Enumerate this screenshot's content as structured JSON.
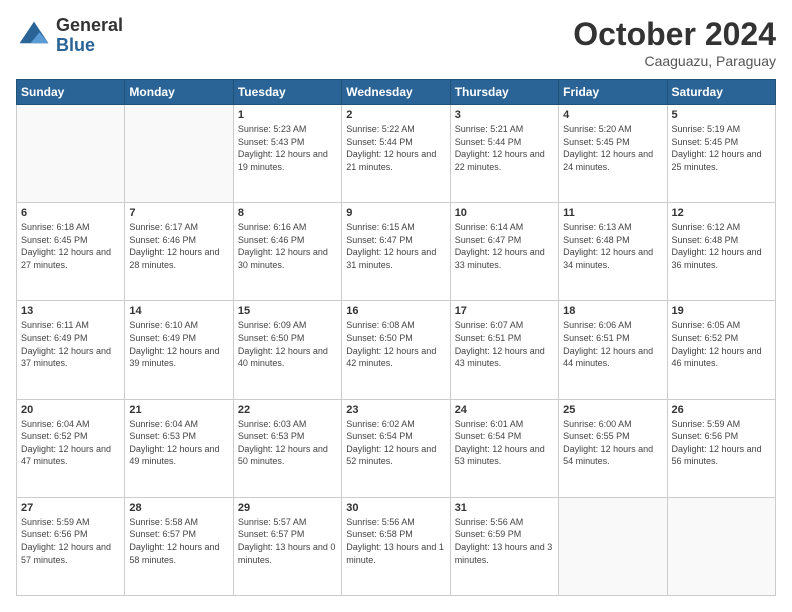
{
  "header": {
    "logo_general": "General",
    "logo_blue": "Blue",
    "month_title": "October 2024",
    "location": "Caaguazu, Paraguay"
  },
  "days_of_week": [
    "Sunday",
    "Monday",
    "Tuesday",
    "Wednesday",
    "Thursday",
    "Friday",
    "Saturday"
  ],
  "weeks": [
    [
      {
        "day": "",
        "info": ""
      },
      {
        "day": "",
        "info": ""
      },
      {
        "day": "1",
        "info": "Sunrise: 5:23 AM\nSunset: 5:43 PM\nDaylight: 12 hours\nand 19 minutes."
      },
      {
        "day": "2",
        "info": "Sunrise: 5:22 AM\nSunset: 5:44 PM\nDaylight: 12 hours\nand 21 minutes."
      },
      {
        "day": "3",
        "info": "Sunrise: 5:21 AM\nSunset: 5:44 PM\nDaylight: 12 hours\nand 22 minutes."
      },
      {
        "day": "4",
        "info": "Sunrise: 5:20 AM\nSunset: 5:45 PM\nDaylight: 12 hours\nand 24 minutes."
      },
      {
        "day": "5",
        "info": "Sunrise: 5:19 AM\nSunset: 5:45 PM\nDaylight: 12 hours\nand 25 minutes."
      }
    ],
    [
      {
        "day": "6",
        "info": "Sunrise: 6:18 AM\nSunset: 6:45 PM\nDaylight: 12 hours\nand 27 minutes."
      },
      {
        "day": "7",
        "info": "Sunrise: 6:17 AM\nSunset: 6:46 PM\nDaylight: 12 hours\nand 28 minutes."
      },
      {
        "day": "8",
        "info": "Sunrise: 6:16 AM\nSunset: 6:46 PM\nDaylight: 12 hours\nand 30 minutes."
      },
      {
        "day": "9",
        "info": "Sunrise: 6:15 AM\nSunset: 6:47 PM\nDaylight: 12 hours\nand 31 minutes."
      },
      {
        "day": "10",
        "info": "Sunrise: 6:14 AM\nSunset: 6:47 PM\nDaylight: 12 hours\nand 33 minutes."
      },
      {
        "day": "11",
        "info": "Sunrise: 6:13 AM\nSunset: 6:48 PM\nDaylight: 12 hours\nand 34 minutes."
      },
      {
        "day": "12",
        "info": "Sunrise: 6:12 AM\nSunset: 6:48 PM\nDaylight: 12 hours\nand 36 minutes."
      }
    ],
    [
      {
        "day": "13",
        "info": "Sunrise: 6:11 AM\nSunset: 6:49 PM\nDaylight: 12 hours\nand 37 minutes."
      },
      {
        "day": "14",
        "info": "Sunrise: 6:10 AM\nSunset: 6:49 PM\nDaylight: 12 hours\nand 39 minutes."
      },
      {
        "day": "15",
        "info": "Sunrise: 6:09 AM\nSunset: 6:50 PM\nDaylight: 12 hours\nand 40 minutes."
      },
      {
        "day": "16",
        "info": "Sunrise: 6:08 AM\nSunset: 6:50 PM\nDaylight: 12 hours\nand 42 minutes."
      },
      {
        "day": "17",
        "info": "Sunrise: 6:07 AM\nSunset: 6:51 PM\nDaylight: 12 hours\nand 43 minutes."
      },
      {
        "day": "18",
        "info": "Sunrise: 6:06 AM\nSunset: 6:51 PM\nDaylight: 12 hours\nand 44 minutes."
      },
      {
        "day": "19",
        "info": "Sunrise: 6:05 AM\nSunset: 6:52 PM\nDaylight: 12 hours\nand 46 minutes."
      }
    ],
    [
      {
        "day": "20",
        "info": "Sunrise: 6:04 AM\nSunset: 6:52 PM\nDaylight: 12 hours\nand 47 minutes."
      },
      {
        "day": "21",
        "info": "Sunrise: 6:04 AM\nSunset: 6:53 PM\nDaylight: 12 hours\nand 49 minutes."
      },
      {
        "day": "22",
        "info": "Sunrise: 6:03 AM\nSunset: 6:53 PM\nDaylight: 12 hours\nand 50 minutes."
      },
      {
        "day": "23",
        "info": "Sunrise: 6:02 AM\nSunset: 6:54 PM\nDaylight: 12 hours\nand 52 minutes."
      },
      {
        "day": "24",
        "info": "Sunrise: 6:01 AM\nSunset: 6:54 PM\nDaylight: 12 hours\nand 53 minutes."
      },
      {
        "day": "25",
        "info": "Sunrise: 6:00 AM\nSunset: 6:55 PM\nDaylight: 12 hours\nand 54 minutes."
      },
      {
        "day": "26",
        "info": "Sunrise: 5:59 AM\nSunset: 6:56 PM\nDaylight: 12 hours\nand 56 minutes."
      }
    ],
    [
      {
        "day": "27",
        "info": "Sunrise: 5:59 AM\nSunset: 6:56 PM\nDaylight: 12 hours\nand 57 minutes."
      },
      {
        "day": "28",
        "info": "Sunrise: 5:58 AM\nSunset: 6:57 PM\nDaylight: 12 hours\nand 58 minutes."
      },
      {
        "day": "29",
        "info": "Sunrise: 5:57 AM\nSunset: 6:57 PM\nDaylight: 13 hours\nand 0 minutes."
      },
      {
        "day": "30",
        "info": "Sunrise: 5:56 AM\nSunset: 6:58 PM\nDaylight: 13 hours\nand 1 minute."
      },
      {
        "day": "31",
        "info": "Sunrise: 5:56 AM\nSunset: 6:59 PM\nDaylight: 13 hours\nand 3 minutes."
      },
      {
        "day": "",
        "info": ""
      },
      {
        "day": "",
        "info": ""
      }
    ]
  ]
}
